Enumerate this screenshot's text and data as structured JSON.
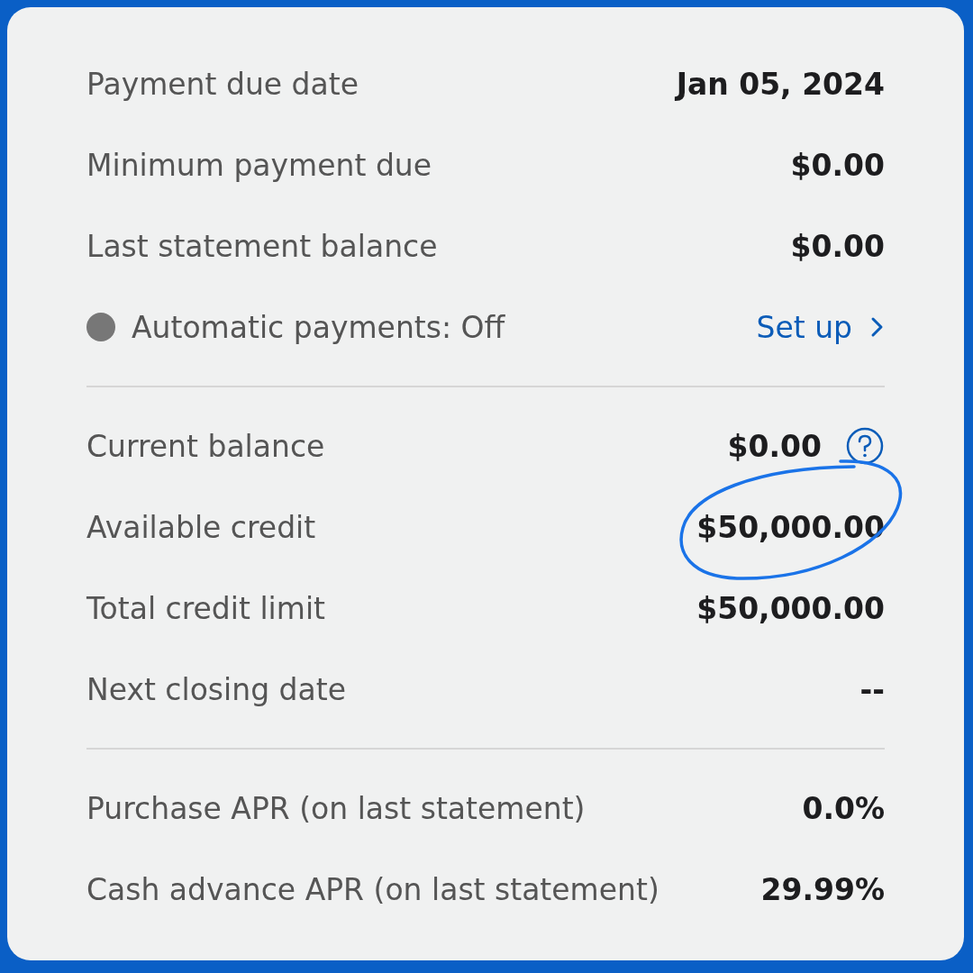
{
  "sections": [
    {
      "rows": [
        {
          "kind": "plain",
          "label": "Payment due date",
          "value": "Jan 05, 2024"
        },
        {
          "kind": "plain",
          "label": "Minimum payment due",
          "value": "$0.00"
        },
        {
          "kind": "plain",
          "label": "Last statement balance",
          "value": "$0.00"
        },
        {
          "kind": "autopay",
          "label": "Automatic payments: Off",
          "on": false,
          "link": "Set up"
        }
      ]
    },
    {
      "rows": [
        {
          "kind": "help",
          "label": "Current balance",
          "value": "$0.00"
        },
        {
          "kind": "plain",
          "label": "Available credit",
          "value": "$50,000.00",
          "circled": true
        },
        {
          "kind": "plain",
          "label": "Total credit limit",
          "value": "$50,000.00"
        },
        {
          "kind": "plain",
          "label": "Next closing date",
          "value": "--"
        }
      ]
    },
    {
      "rows": [
        {
          "kind": "plain",
          "label": "Purchase APR (on last statement)",
          "value": "0.0%"
        },
        {
          "kind": "plain",
          "label": "Cash advance APR (on last statement)",
          "value": "29.99%"
        }
      ]
    }
  ]
}
